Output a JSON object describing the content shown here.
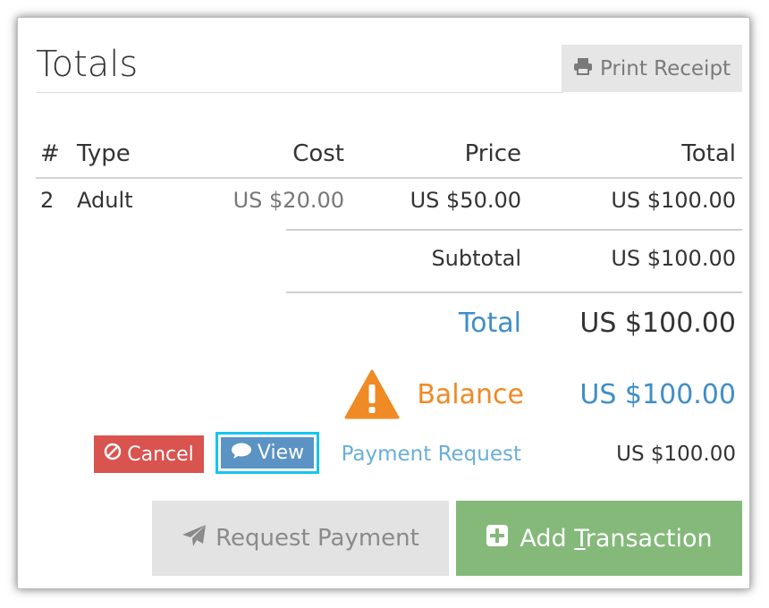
{
  "panel": {
    "title": "Totals",
    "print_label": "Print Receipt"
  },
  "table": {
    "headers": {
      "num": "#",
      "type": "Type",
      "cost": "Cost",
      "price": "Price",
      "total": "Total"
    },
    "rows": [
      {
        "num": "2",
        "type": "Adult",
        "cost": "US $20.00",
        "price": "US $50.00",
        "total": "US $100.00"
      }
    ],
    "subtotal_label": "Subtotal",
    "subtotal_value": "US $100.00"
  },
  "summary": {
    "total_label": "Total",
    "total_value": "US $100.00",
    "balance_label": "Balance",
    "balance_value": "US $100.00"
  },
  "payment_request": {
    "cancel_label": "Cancel",
    "view_label": "View",
    "link_label": "Payment Request",
    "amount": "US $100.00"
  },
  "actions": {
    "request_label": "Request Payment",
    "add_prefix": "Add ",
    "add_underlined": "T",
    "add_suffix": "ransaction"
  },
  "colors": {
    "total_blue": "#3f8ec6",
    "balance_orange": "#f08a24",
    "cancel_red": "#d9534f",
    "view_blue": "#5b93c4",
    "focus_cyan": "#16c5ee",
    "add_green": "#84b97a"
  },
  "icons": [
    "print-icon",
    "warning-icon",
    "ban-icon",
    "comment-icon",
    "paper-plane-icon",
    "plus-square-icon"
  ]
}
